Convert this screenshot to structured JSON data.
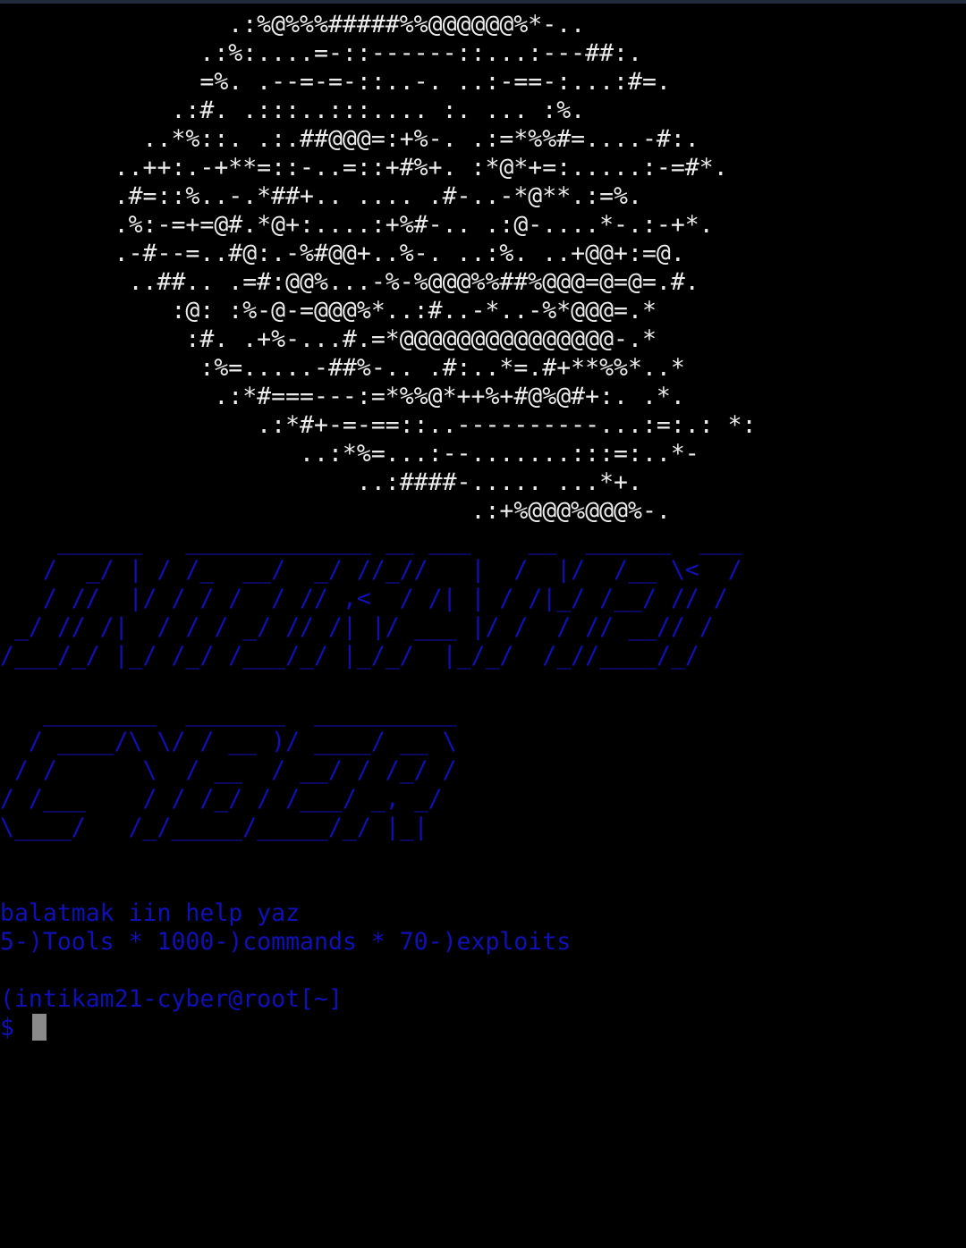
{
  "terminal": {
    "skull_art": [
      "                .:%@%%%#####%%@@@@@@%*-..",
      "              .:%:....=-::------::...:---##:.",
      "              =%. .--=-=-::..-. ..:-==-:...:#=.",
      "            .:#. .:::..:::.... :. ... :%.",
      "          ..*%::. .:.##@@@=:+%-. .:=*%%#=....-#:.",
      "        ..++:.-+**=::-..=::+#%+. :*@*+=:.....:-=#*.",
      "        .#=::%..-.*##+.. .... .#-..-*@**.:=%.",
      "        .%:-=+=@#.*@+:....:+%#-.. .:@-....*-.:-+*.",
      "        .-#--=..#@:.-%#@@+..%-. ..:%. ..+@@+:=@.",
      "         ..##.. .=#:@@%...-%-%@@@%%##%@@@=@=@=.#.",
      "            :@: :%-@-=@@@%*..:#..-*..-%*@@@=.*",
      "             :#. .+%-...#.=*@@@@@@@@@@@@@@@-.*",
      "              :%=.....-##%-.. .#:..*=.#+**%%*..*",
      "               .:*#===---:=*%%@*++%+#@%@#+:. .*.",
      "                  .:*#+-=-==::..----------...:=:.: *:",
      "                     ..:*%=...:--.......:::=:..*-",
      "                         ..:####-..... ...*+.",
      "                                 .:+%@@@%@@@%-."
    ],
    "intikam_art": [
      "    ______   _____________ __ ___    __  ______  ___",
      "   /  _/ | / /_  __/  _/ //_//   |  /  |/  /__ \\<  /",
      "   / //  |/ / / /  / // ,<  / /| | / /|_/ /__/ // / ",
      " _/ // /|  / / / _/ // /| |/ ___ |/ /  / // __// /  ",
      "/___/_/ |_/ /_/ /___/_/ |_/_/  |_/_/  /_//____/_/   "
    ],
    "cyber_art": [
      "   ________  _______  __________ ",
      "  / ____/\\ \\/ / __ )/ ____/ __ \\",
      " / /      \\  / __  / __/ / /_/ /",
      "/ /___    / / /_/ / /___/ _, _/ ",
      "\\____/   /_/_____/_____/_/ |_|  "
    ],
    "info_line1": "balatmak iin help yaz",
    "info_line2": "5-)Tools * 1000-)commands * 70-)exploits",
    "prompt_line": "(intikam21-cyber@root[~]",
    "prompt_symbol": "$ "
  },
  "colors": {
    "background": "#000000",
    "art_white": "#ececec",
    "blue": "#1010b8",
    "cursor": "#8a8a8a"
  }
}
